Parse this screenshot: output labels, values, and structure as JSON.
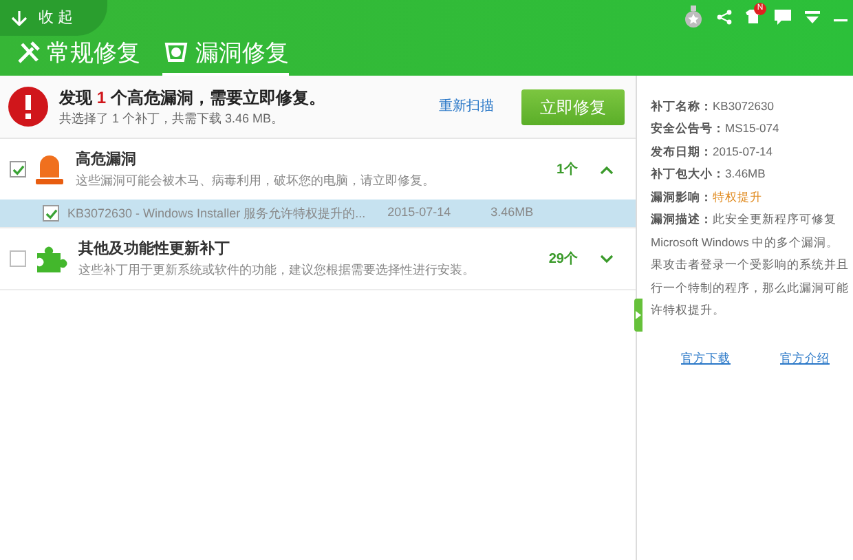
{
  "header": {
    "collapse_label": "收 起",
    "badge": "N"
  },
  "tabs": [
    {
      "label": "常规修复",
      "selected": false
    },
    {
      "label": "漏洞修复",
      "selected": true
    }
  ],
  "alert": {
    "title": "发现 **1** 个高危漏洞，需要立即修复。",
    "subtitle": "共选择了 1 个补丁，共需下载 3.46 MB。",
    "rescan": "重新扫描",
    "fix_button": "立即修复"
  },
  "groups": [
    {
      "kind": "alarm",
      "title": "高危漏洞",
      "description": "这些漏洞可能会被木马、病毒利用，破坏您的电脑，请立即修复。",
      "count": "1个",
      "checked": true,
      "expanded": true,
      "items": [
        {
          "name": "KB3072630 - Windows Installer 服务允许特权提升的...",
          "date": "2015-07-14",
          "size": "3.46MB",
          "checked": true,
          "selected": true
        }
      ]
    },
    {
      "kind": "puzzle",
      "title": "其他及功能性更新补丁",
      "description": "这些补丁用于更新系统或软件的功能，建议您根据需要选择性进行安装。",
      "count": "29个",
      "checked": false,
      "expanded": false
    }
  ],
  "details": {
    "fields": [
      {
        "label": "补丁名称：",
        "value": "KB3072630",
        "highlight": false
      },
      {
        "label": "安全公告号：",
        "value": "MS15-074",
        "highlight": false
      },
      {
        "label": "发布日期：",
        "value": "2015-07-14",
        "highlight": false
      },
      {
        "label": "补丁包大小：",
        "value": "3.46MB",
        "highlight": false
      },
      {
        "label": "漏洞影响：",
        "value": "特权提升",
        "highlight": true
      }
    ],
    "description_label": "漏洞描述：",
    "description_lines": [
      "此安全更新程序可修复",
      "Microsoft Windows 中的多个漏洞。",
      "果攻击者登录一个受影响的系统并且",
      "行一个特制的程序，那么此漏洞可能",
      "许特权提升。"
    ],
    "links": [
      "官方下载",
      "官方介绍"
    ]
  }
}
